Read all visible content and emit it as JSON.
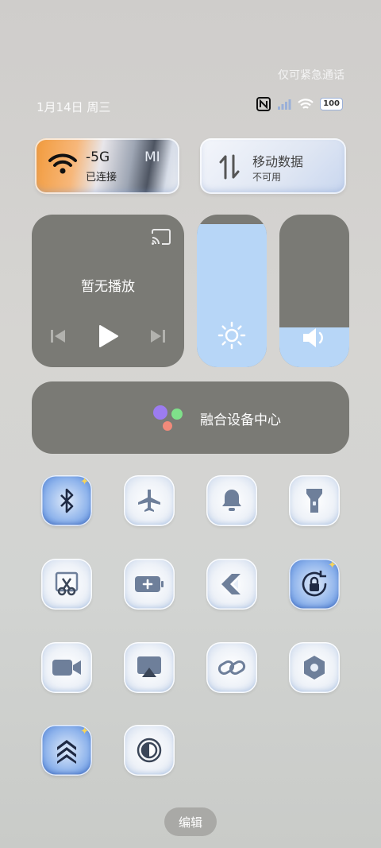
{
  "status_bar": {
    "emergency_text": "仅可紧急通话",
    "date_text": "1月14日 周三",
    "battery_level": "100",
    "icons": [
      "nfc-icon",
      "signal-icon",
      "wifi-icon",
      "battery-icon"
    ]
  },
  "wifi_tile": {
    "title": "-5G",
    "mi_text": "MI",
    "subtitle": "已连接",
    "accent_color": "#f29a3a"
  },
  "mobile_data_tile": {
    "title": "移动数据",
    "subtitle": "不可用"
  },
  "media": {
    "title": "暂无播放",
    "icons": [
      "cast-icon",
      "previous-icon",
      "play-icon",
      "next-icon"
    ]
  },
  "brightness": {
    "level_percent": 94,
    "icon": "sun-icon"
  },
  "volume": {
    "level_percent": 26,
    "icon": "speaker-icon"
  },
  "fusion": {
    "label": "融合设备中心"
  },
  "toggles": [
    {
      "name": "bluetooth",
      "icon": "bluetooth-icon",
      "active": true
    },
    {
      "name": "airplane",
      "icon": "airplane-icon",
      "active": false
    },
    {
      "name": "bell",
      "icon": "bell-icon",
      "active": false
    },
    {
      "name": "flashlight",
      "icon": "flashlight-icon",
      "active": false
    },
    {
      "name": "screenshot",
      "icon": "scissors-icon",
      "active": false
    },
    {
      "name": "battery-saver",
      "icon": "battery-plus-icon",
      "active": false
    },
    {
      "name": "share",
      "icon": "share-icon",
      "active": false
    },
    {
      "name": "rotation-lock",
      "icon": "rotation-lock-icon",
      "active": true
    },
    {
      "name": "screen-record",
      "icon": "video-icon",
      "active": false
    },
    {
      "name": "screen-cast",
      "icon": "cast-screen-icon",
      "active": false
    },
    {
      "name": "link",
      "icon": "link-icon",
      "active": false
    },
    {
      "name": "settings",
      "icon": "hexagon-icon",
      "active": false
    },
    {
      "name": "performance",
      "icon": "chevrons-up-icon",
      "active": true
    },
    {
      "name": "dark-mode",
      "icon": "contrast-icon",
      "active": false
    }
  ],
  "edit_label": "编辑",
  "colors": {
    "tile_gray": "#7a7a75",
    "slider_fill": "#b7d6f7",
    "active_blue": "#4f82d6"
  }
}
